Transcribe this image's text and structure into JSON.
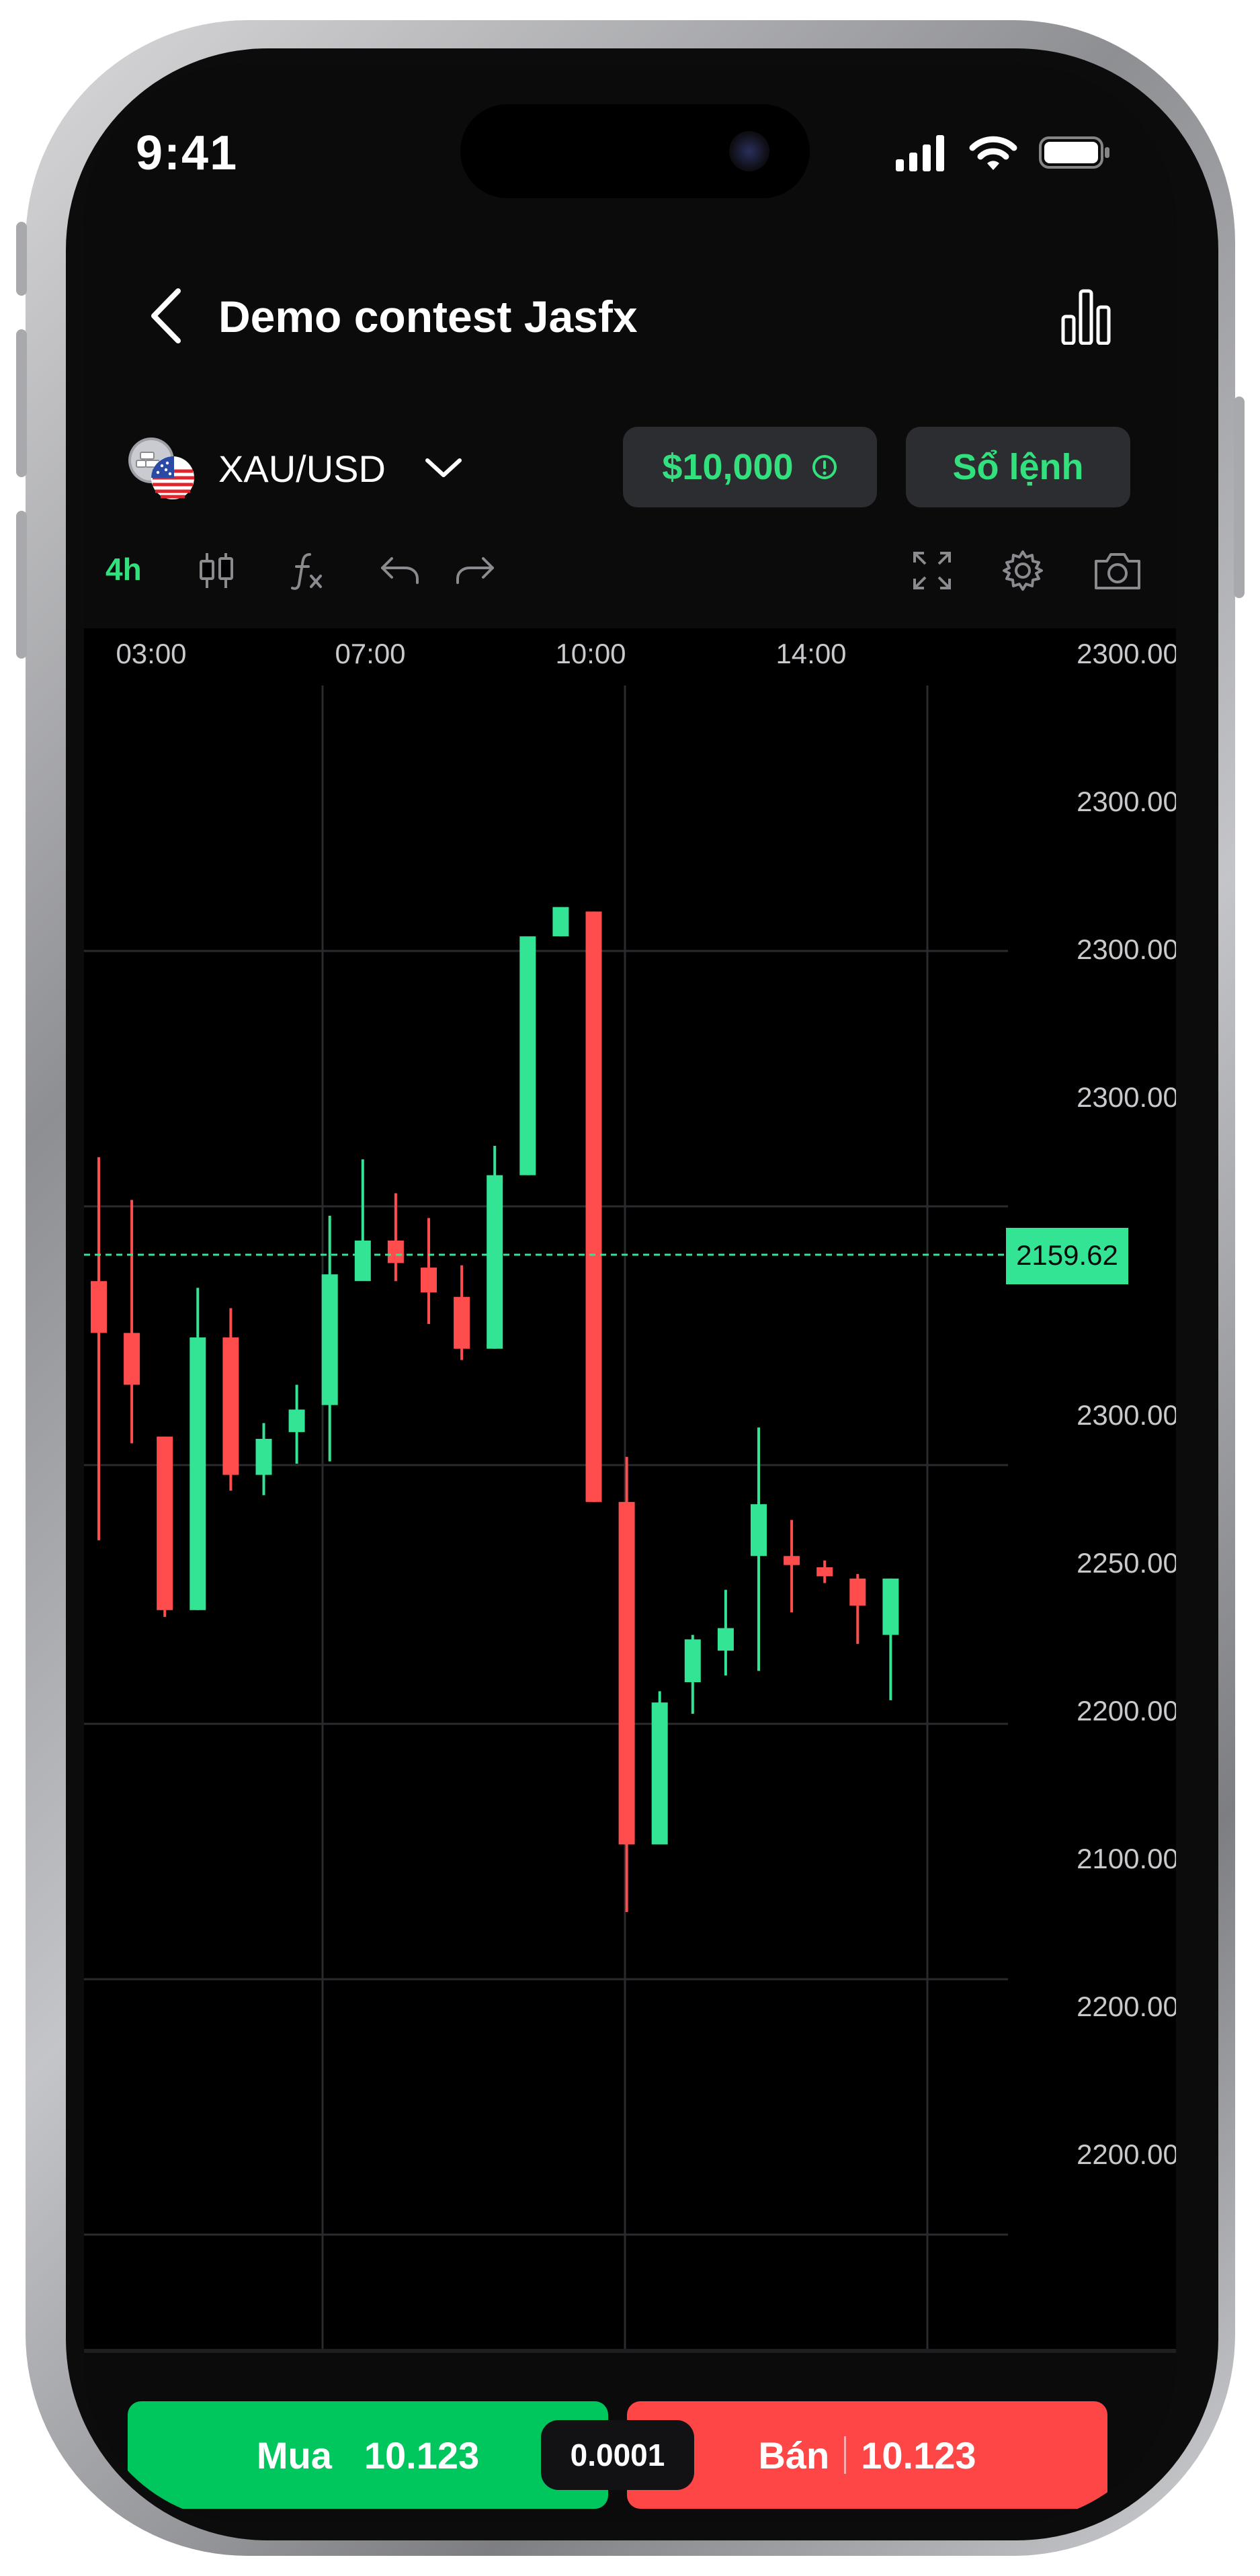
{
  "status_bar": {
    "time": "9:41"
  },
  "header": {
    "title": "Demo contest Jasfx"
  },
  "symbol": {
    "name": "XAU/USD"
  },
  "account": {
    "balance": "$10,000",
    "order_book_label": "Sổ lệnh"
  },
  "toolbar": {
    "timeframe": "4h"
  },
  "chart_data": {
    "type": "candlestick",
    "x_tick_labels": [
      "03:00",
      "07:00",
      "10:00",
      "14:00"
    ],
    "y_tick_labels": [
      "2300.00",
      "2300.00",
      "2300.00",
      "2300.00",
      "2300.00",
      "2250.00",
      "2200.00",
      "2100.00",
      "2200.00",
      "2200.00"
    ],
    "current_price": "2159.62",
    "colors": {
      "up": "#32e493",
      "down": "#ff4d4d",
      "price_label_bg": "#32e493"
    },
    "candles": [
      {
        "open": 2327,
        "high": 2382,
        "low": 2212,
        "close": 2304,
        "dir": "down"
      },
      {
        "open": 2304,
        "high": 2363,
        "low": 2255,
        "close": 2281,
        "dir": "down"
      },
      {
        "open": 2258,
        "high": 2258,
        "low": 2178,
        "close": 2181,
        "dir": "down"
      },
      {
        "open": 2181,
        "high": 2324,
        "low": 2181,
        "close": 2302,
        "dir": "up"
      },
      {
        "open": 2302,
        "high": 2315,
        "low": 2234,
        "close": 2241,
        "dir": "down"
      },
      {
        "open": 2241,
        "high": 2264,
        "low": 2232,
        "close": 2257,
        "dir": "up"
      },
      {
        "open": 2260,
        "high": 2281,
        "low": 2246,
        "close": 2270,
        "dir": "up"
      },
      {
        "open": 2272,
        "high": 2356,
        "low": 2247,
        "close": 2330,
        "dir": "up"
      },
      {
        "open": 2327,
        "high": 2381,
        "low": 2336,
        "close": 2345,
        "dir": "up"
      },
      {
        "open": 2345,
        "high": 2366,
        "low": 2327,
        "close": 2335,
        "dir": "down"
      },
      {
        "open": 2333,
        "high": 2355,
        "low": 2308,
        "close": 2322,
        "dir": "down"
      },
      {
        "open": 2320,
        "high": 2334,
        "low": 2292,
        "close": 2297,
        "dir": "down"
      },
      {
        "open": 2297,
        "high": 2387,
        "low": 2297,
        "close": 2374,
        "dir": "up"
      },
      {
        "open": 2374,
        "high": 2385,
        "low": 2374,
        "close": 2480,
        "dir": "up"
      },
      {
        "open": 2480,
        "high": 2490,
        "low": 2480,
        "close": 2493,
        "dir": "up"
      },
      {
        "open": 2491,
        "high": 2491,
        "low": 2229,
        "close": 2229,
        "dir": "down"
      },
      {
        "open": 2229,
        "high": 2249,
        "low": 2047,
        "close": 2077,
        "dir": "down"
      },
      {
        "open": 2077,
        "high": 2145,
        "low": 2077,
        "close": 2140,
        "dir": "up"
      },
      {
        "open": 2149,
        "high": 2170,
        "low": 2135,
        "close": 2168,
        "dir": "up"
      },
      {
        "open": 2163,
        "high": 2190,
        "low": 2152,
        "close": 2173,
        "dir": "up"
      },
      {
        "open": 2205,
        "high": 2262,
        "low": 2154,
        "close": 2228,
        "dir": "up"
      },
      {
        "open": 2205,
        "high": 2221,
        "low": 2180,
        "close": 2201,
        "dir": "down"
      },
      {
        "open": 2200,
        "high": 2203,
        "low": 2193,
        "close": 2196,
        "dir": "down"
      },
      {
        "open": 2183,
        "high": 2197,
        "low": 2166,
        "close": 2195,
        "dir": "down"
      },
      {
        "open": 2195,
        "high": 2195,
        "low": 2141,
        "close": 2170,
        "dir": "up"
      }
    ]
  },
  "trade": {
    "buy_label": "Mua",
    "buy_price": "10.123",
    "spread": "0.0001",
    "sell_label": "Bán",
    "sell_price": "10.123"
  }
}
